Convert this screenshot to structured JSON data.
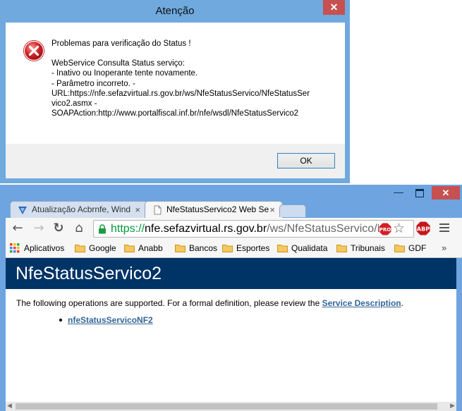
{
  "dialog": {
    "title": "Atenção",
    "close_glyph": "✕",
    "icon": "error-icon",
    "lines": [
      "Problemas para verificação do Status !",
      "",
      "WebService Consulta Status serviço:",
      "- Inativo ou Inoperante tente novamente.",
      "- Parâmetro incorreto. -",
      "URL:https://nfe.sefazvirtual.rs.gov.br/ws/NfeStatusServico/NfeStatusSer",
      "vico2.asmx -",
      "SOAPAction:http://www.portalfiscal.inf.br/nfe/wsdl/NfeStatusServico2"
    ],
    "ok_label": "OK"
  },
  "browser": {
    "window_controls": {
      "minimize": "—",
      "close": "✕"
    },
    "tabs": [
      {
        "title": "Atualização Acbrnfe, Wind",
        "close": "×",
        "icon": "acbr-icon",
        "active": false
      },
      {
        "title": "NfeStatusServico2 Web Se",
        "close": "×",
        "icon": "page-icon",
        "active": true
      }
    ],
    "nav": {
      "back": "←",
      "forward": "→",
      "reload": "↻",
      "home": "⌂"
    },
    "url": {
      "scheme": "https://",
      "host": "nfe.sefazvirtual.rs.gov.br",
      "path": "/ws/NfeStatusServico/N"
    },
    "bookmarks": [
      {
        "label": "Aplicativos",
        "icon": "apps-icon"
      },
      {
        "label": "Google",
        "icon": "folder-icon"
      },
      {
        "label": "Anabb",
        "icon": "folder-icon"
      },
      {
        "label": "Bancos",
        "icon": "folder-icon"
      },
      {
        "label": "Esportes",
        "icon": "folder-icon"
      },
      {
        "label": "Qualidata",
        "icon": "folder-icon"
      },
      {
        "label": "Tribunais",
        "icon": "folder-icon"
      },
      {
        "label": "GDF",
        "icon": "folder-icon"
      }
    ],
    "bookmarks_more": "»",
    "page": {
      "heading": "NfeStatusServico2",
      "intro_text": "The following operations are supported. For a formal definition, please review the ",
      "intro_link": "Service Description",
      "intro_end": ".",
      "operations": [
        "nfeStatusServicoNF2"
      ]
    },
    "scroll": {
      "left": "◀",
      "right": "▶"
    }
  },
  "colors": {
    "banner": "#003366",
    "link": "#336699",
    "https_green": "#009a3e",
    "window_frame": "#6ea5e0",
    "close_red": "#c75050"
  }
}
